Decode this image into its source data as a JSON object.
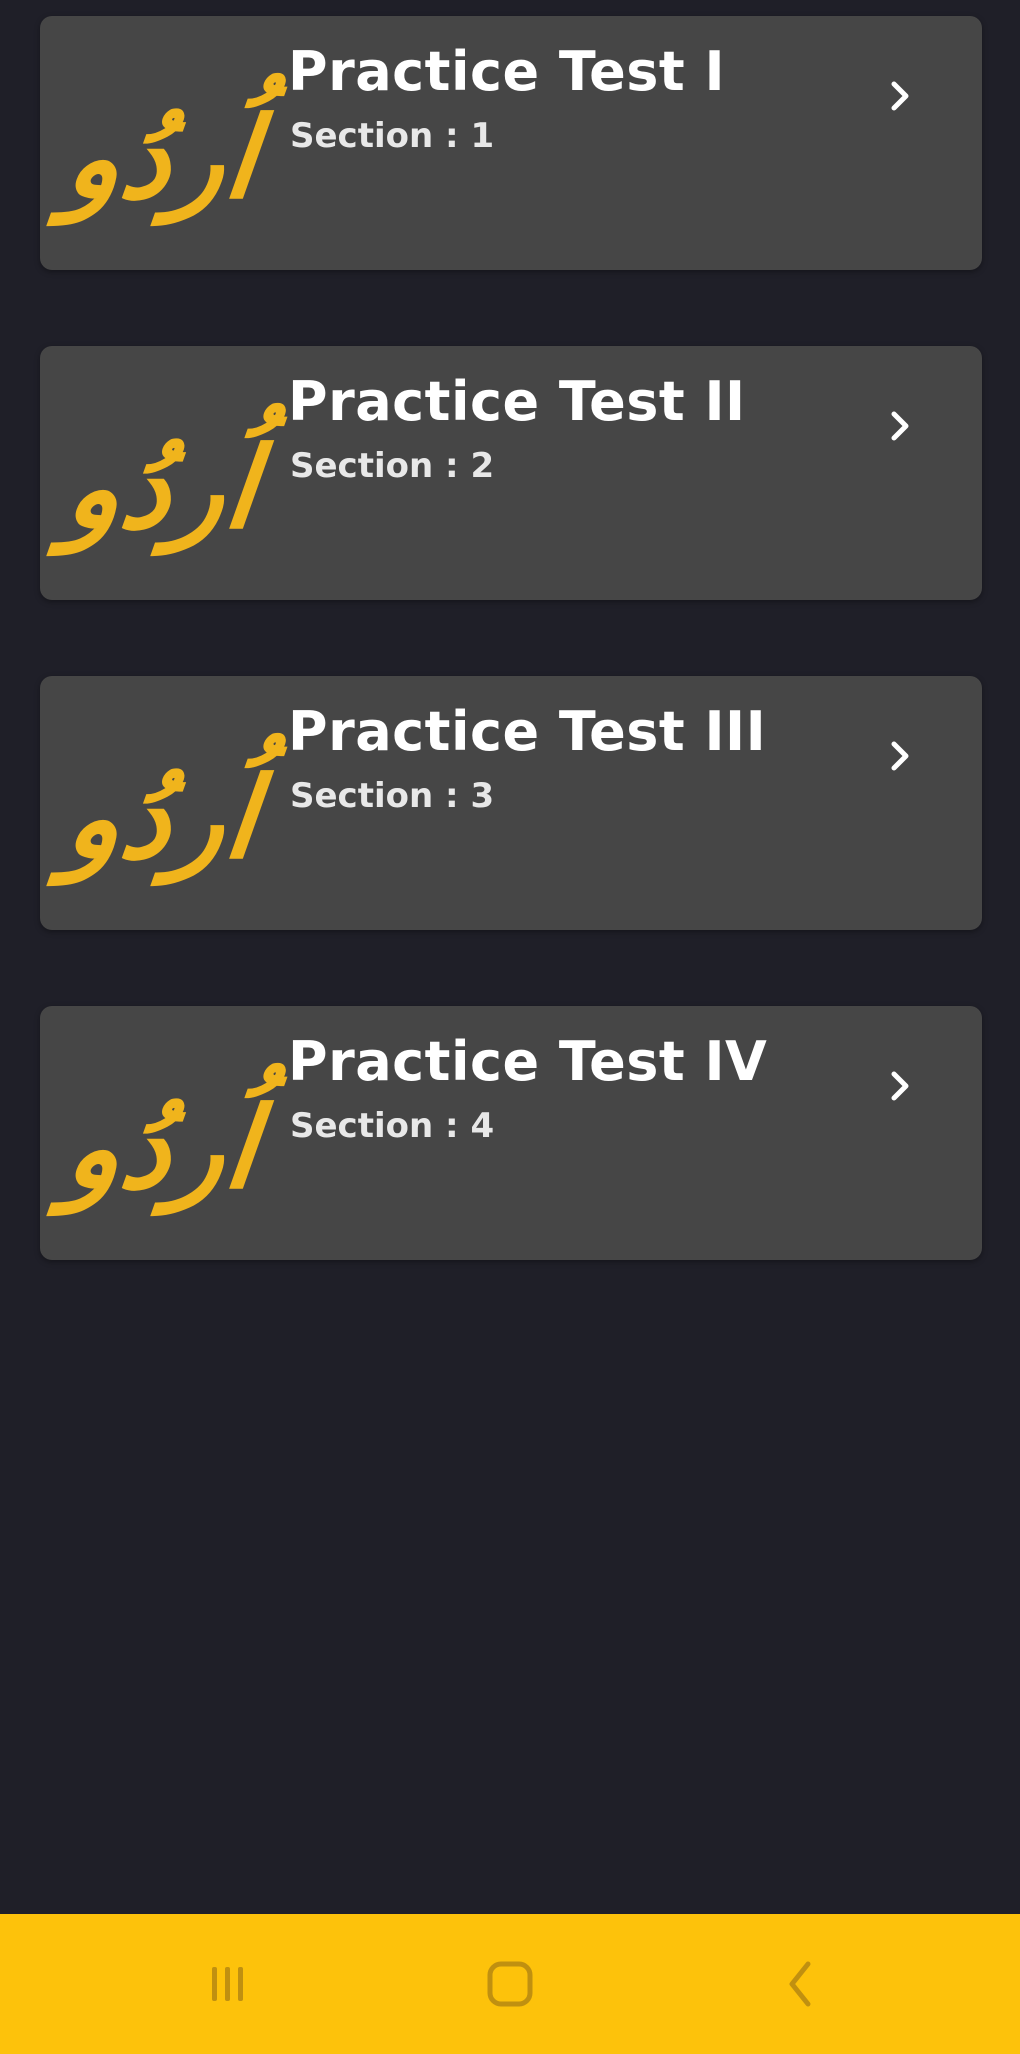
{
  "tests": [
    {
      "title": "Practice Test I",
      "section": "Section : 1",
      "logo_text": "اُردُو"
    },
    {
      "title": "Practice Test II",
      "section": "Section : 2",
      "logo_text": "اُردُو"
    },
    {
      "title": "Practice Test III",
      "section": "Section : 3",
      "logo_text": "اُردُو"
    },
    {
      "title": "Practice Test IV",
      "section": "Section : 4",
      "logo_text": "اُردُو"
    }
  ],
  "icons": {
    "chevron": "chevron-right-icon",
    "nav_recents": "recents-icon",
    "nav_home": "home-icon",
    "nav_back": "back-icon"
  },
  "colors": {
    "background": "#1f1f28",
    "card": "#464646",
    "accent": "#fdc20b",
    "logo": "#f0b41c",
    "text": "#ffffff"
  }
}
